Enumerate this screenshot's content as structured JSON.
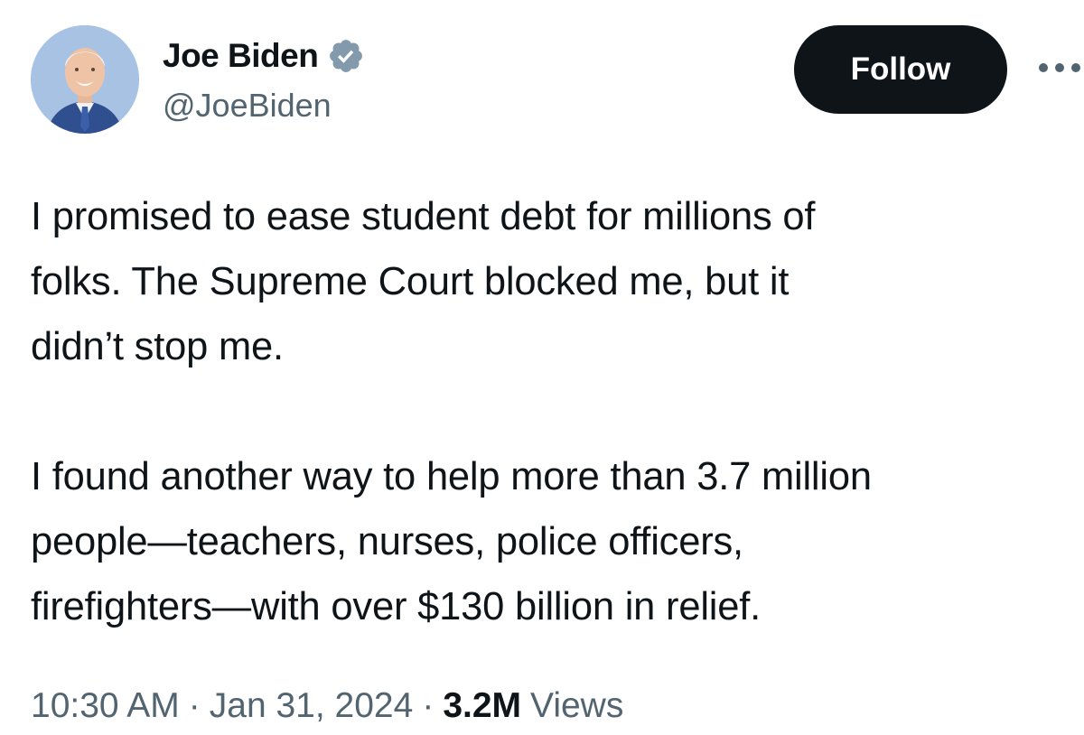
{
  "author": {
    "display_name": "Joe Biden",
    "handle": "@JoeBiden",
    "verified_icon": "verified-badge-icon",
    "verified_color": "#829aab"
  },
  "actions": {
    "follow_label": "Follow",
    "more_icon": "more-horizontal-icon"
  },
  "tweet": {
    "paragraph_1": [
      "I promised to ease student debt for millions of",
      "folks. The Supreme Court blocked me, but it",
      "didn’t stop me."
    ],
    "paragraph_2": [
      "I found another way to help more than 3.7 million",
      "people—teachers, nurses, police officers,",
      "firefighters—with over $130 billion in relief."
    ]
  },
  "meta": {
    "time": "10:30 AM",
    "date": "Jan 31, 2024",
    "separator": "·",
    "views_count": "3.2M",
    "views_label": "Views"
  },
  "colors": {
    "text_primary": "#0f1419",
    "text_secondary": "#536471",
    "follow_bg": "#0f1419",
    "follow_text": "#ffffff"
  }
}
